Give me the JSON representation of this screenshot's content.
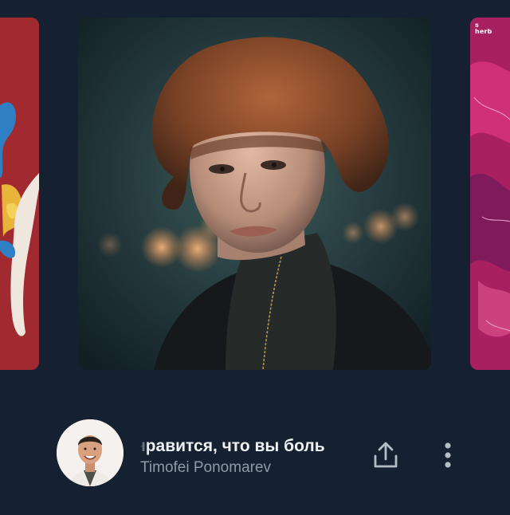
{
  "carousel": {
    "left_card": {
      "icon": "abstract-illustration",
      "color": "#a12a30"
    },
    "center_card": {
      "icon": "portrait-photo"
    },
    "right_card": {
      "icon": "abstract-painting",
      "watermark": "soup herb"
    }
  },
  "now_playing": {
    "title": "нравится, что вы боль",
    "author": "Timofei Ponomarev",
    "share_icon": "share-icon",
    "more_icon": "more-vertical-icon"
  },
  "colors": {
    "background": "#152130",
    "title": "#eef1f4",
    "author": "#8f9aa7"
  }
}
